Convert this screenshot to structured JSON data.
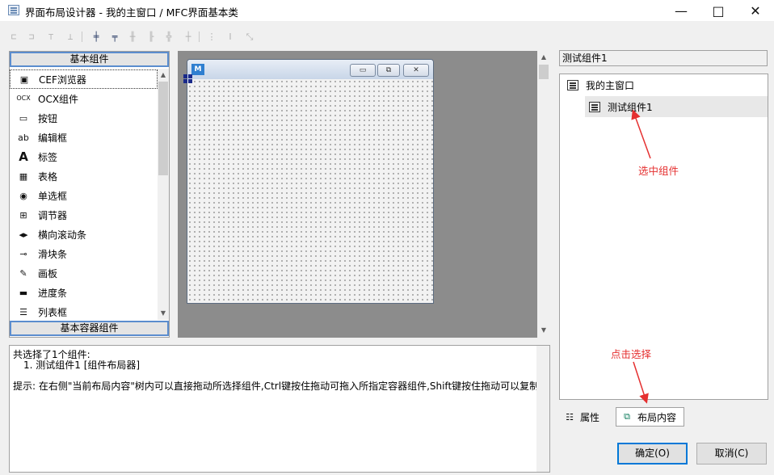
{
  "window": {
    "title": "界面布局设计器 - 我的主窗口 / MFC界面基本类",
    "minimize_icon": "minimize-icon",
    "maximize_icon": "maximize-icon",
    "close_icon": "close-icon"
  },
  "toolbar": {
    "icons": [
      "align-left-icon",
      "align-right-icon",
      "align-top-icon",
      "align-bottom-icon",
      "center-horizontal-icon",
      "center-vertical-icon",
      "distribute-horizontal-icon",
      "distribute-vertical-icon",
      "space-horizontal-icon",
      "space-vertical-icon",
      "same-width-icon",
      "same-height-icon",
      "same-size-icon"
    ]
  },
  "palette": {
    "header": "基本组件",
    "footer": "基本容器组件",
    "items": [
      {
        "label": "CEF浏览器",
        "icon": "browser-icon",
        "glyph": "▣"
      },
      {
        "label": "OCX组件",
        "icon": "ocx-icon",
        "glyph": "OCX"
      },
      {
        "label": "按钮",
        "icon": "button-icon",
        "glyph": "▭"
      },
      {
        "label": "编辑框",
        "icon": "editbox-icon",
        "glyph": "ab"
      },
      {
        "label": "标签",
        "icon": "label-icon",
        "glyph": "A"
      },
      {
        "label": "表格",
        "icon": "table-icon",
        "glyph": "▦"
      },
      {
        "label": "单选框",
        "icon": "radio-icon",
        "glyph": "◉"
      },
      {
        "label": "调节器",
        "icon": "spinner-icon",
        "glyph": "⊞"
      },
      {
        "label": "横向滚动条",
        "icon": "hscrollbar-icon",
        "glyph": "◂▸"
      },
      {
        "label": "滑块条",
        "icon": "slider-icon",
        "glyph": "⊸"
      },
      {
        "label": "画板",
        "icon": "canvas-icon",
        "glyph": "✎"
      },
      {
        "label": "进度条",
        "icon": "progressbar-icon",
        "glyph": "▬"
      },
      {
        "label": "列表框",
        "icon": "listbox-icon",
        "glyph": "☰"
      }
    ],
    "selected_index": 0
  },
  "design": {
    "logo_text": "M",
    "window_buttons": [
      "▭",
      "⧉",
      "✕"
    ]
  },
  "description": {
    "line1": "共选择了1个组件:",
    "line2": "1. 测试组件1 [组件布局器]",
    "hint": "提示: 在右侧\"当前布局内容\"树内可以直接拖动所选择组件,Ctrl键按住拖动可拖入所指定容器组件,Shift键按住拖动可以复制."
  },
  "right_panel": {
    "selected_name": "测试组件1",
    "tree": {
      "root": "我的主窗口",
      "child": "测试组件1"
    },
    "annotations": {
      "select_component": "选中组件",
      "click_select": "点击选择"
    },
    "tabs": [
      {
        "label": "属性",
        "icon": "properties-icon",
        "glyph": "☷"
      },
      {
        "label": "布局内容",
        "icon": "layout-icon",
        "glyph": "⧉"
      }
    ],
    "active_tab": 1
  },
  "buttons": {
    "ok": "确定(O)",
    "cancel": "取消(C)"
  },
  "colors": {
    "annotation": "#e53030",
    "accent": "#0078d7",
    "header_border": "#5b8dce"
  }
}
